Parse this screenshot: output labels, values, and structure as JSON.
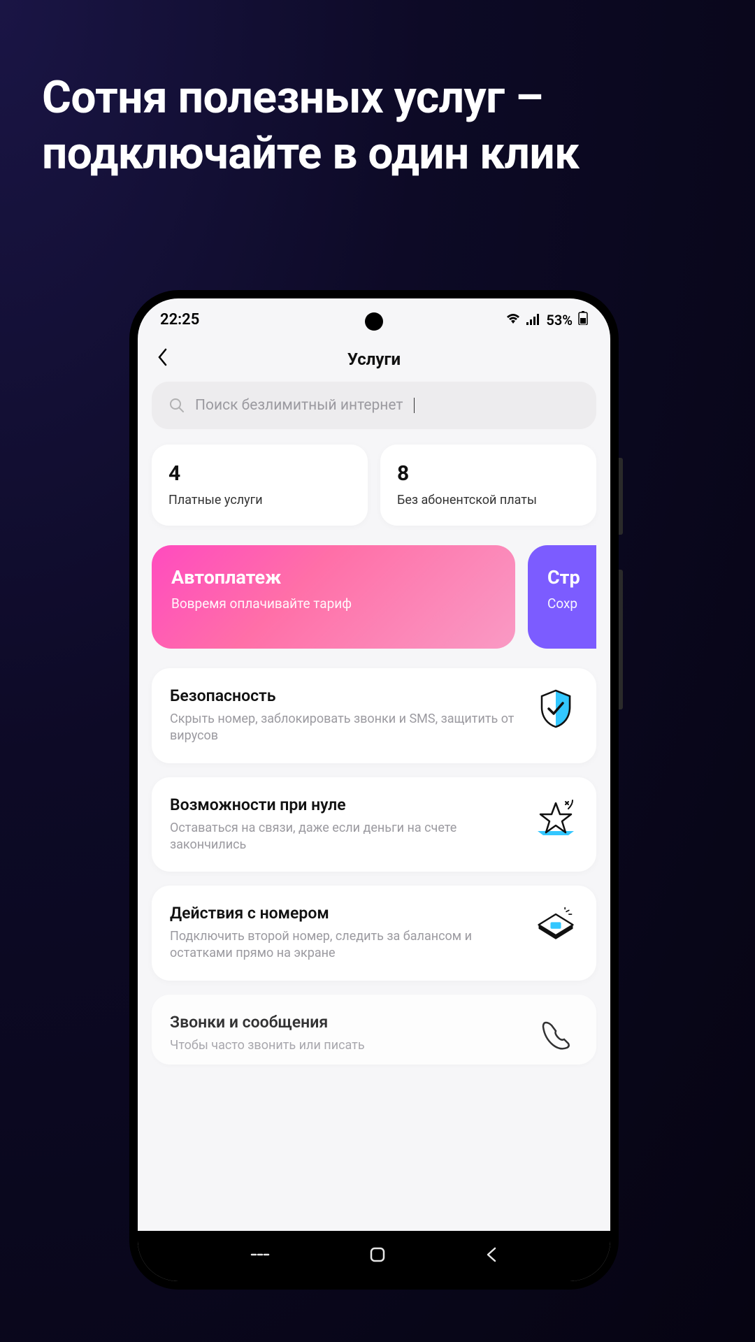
{
  "headline": {
    "line1": "Сотня полезных услуг –",
    "line2": "подключайте в один клик"
  },
  "status": {
    "time": "22:25",
    "battery_pct": "53%"
  },
  "header": {
    "title": "Услуги"
  },
  "search": {
    "placeholder": "Поиск безлимитный интернет"
  },
  "stats": [
    {
      "count": "4",
      "label": "Платные услуги"
    },
    {
      "count": "8",
      "label": "Без абонентской платы"
    }
  ],
  "promos": [
    {
      "title": "Автоплатеж",
      "subtitle": "Вовремя оплачивайте тариф"
    },
    {
      "title": "Стр",
      "subtitle": "Сохр"
    }
  ],
  "services": [
    {
      "title": "Безопасность",
      "desc": "Скрыть номер, заблокировать звонки и SMS, защитить от вирусов",
      "icon": "shield-check"
    },
    {
      "title": "Возможности при нуле",
      "desc": "Оставаться на связи, даже если деньги на счете закончились",
      "icon": "star"
    },
    {
      "title": "Действия с номером",
      "desc": "Подключить второй номер, следить за балансом и остатками прямо на экране",
      "icon": "sim-card"
    },
    {
      "title": "Звонки и сообщения",
      "desc": "Чтобы часто звонить или писать",
      "icon": "phone"
    }
  ]
}
